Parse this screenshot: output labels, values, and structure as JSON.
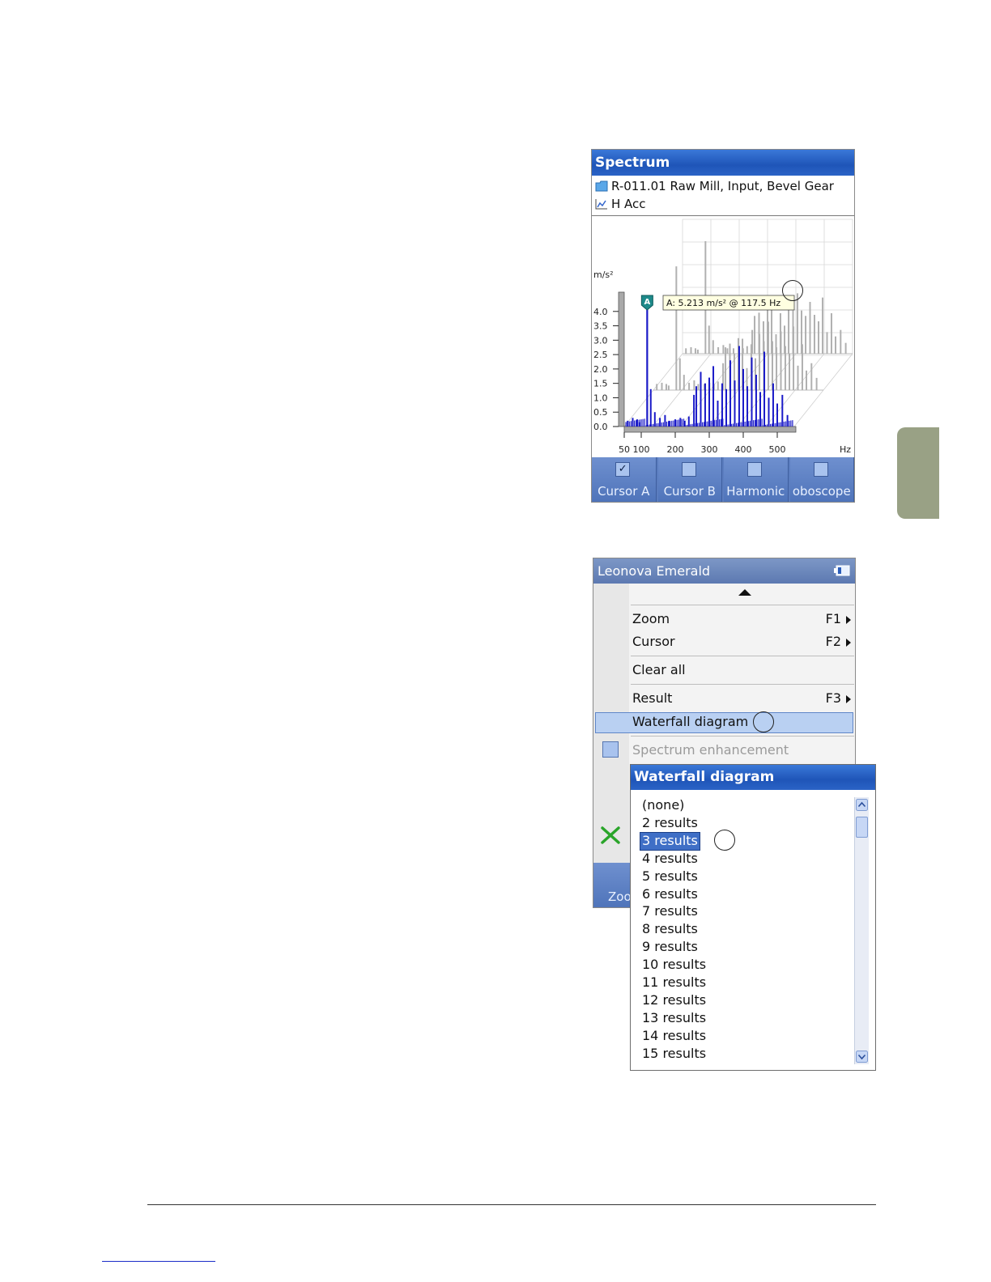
{
  "spectrum": {
    "title": "Spectrum",
    "location": "R-011.01 Raw Mill, Input, Bevel Gear",
    "measurement": "H Acc",
    "chart_data": {
      "type": "bar",
      "y_unit": "m/s²",
      "x_unit": "Hz",
      "y_ticks": [
        "4.0",
        "3.5",
        "3.0",
        "2.5",
        "2.0",
        "1.5",
        "1.0",
        "0.5",
        "0.0"
      ],
      "x_ticks": [
        "50",
        "100",
        "200",
        "300",
        "400",
        "500"
      ],
      "ylim": [
        0,
        4.5
      ],
      "xlim": [
        50,
        550
      ],
      "cursor_label": "A",
      "cursor_readout": "A: 5.213 m/s² @ 117.5 Hz",
      "cursor_x": 117.5,
      "cursor_y": 5.213,
      "series": [
        {
          "x": [
            60,
            75,
            88,
            95,
            117.5,
            128,
            140,
            155,
            170,
            182,
            200,
            215,
            228,
            240,
            255,
            262,
            275,
            288,
            300,
            312,
            325,
            338,
            350,
            362,
            375,
            388,
            400,
            412,
            425,
            438,
            450,
            462,
            475,
            488,
            500,
            515,
            530
          ],
          "values": [
            0.2,
            0.3,
            0.25,
            0.15,
            5.213,
            1.3,
            0.5,
            0.3,
            0.4,
            0.2,
            0.25,
            0.3,
            0.2,
            0.35,
            1.1,
            1.4,
            1.9,
            1.5,
            1.7,
            2.1,
            0.9,
            1.5,
            1.3,
            2.3,
            1.6,
            2.8,
            2.0,
            1.4,
            2.4,
            1.8,
            1.2,
            2.6,
            1.0,
            1.5,
            0.8,
            1.1,
            0.4
          ],
          "color": "#1a1ac8"
        }
      ],
      "background_traces_color": "#b0b0b0"
    },
    "toolbar": [
      {
        "label": "Cursor A",
        "checked": true
      },
      {
        "label": "Cursor B",
        "checked": false
      },
      {
        "label": "Harmonic",
        "checked": false
      },
      {
        "label": "oboscope",
        "checked": false
      }
    ]
  },
  "menu": {
    "title": "Leonova Emerald",
    "items": [
      {
        "label": "Zoom",
        "key": "F1"
      },
      {
        "label": "Cursor",
        "key": "F2"
      },
      {
        "label": "Clear all"
      },
      {
        "label": "Result",
        "key": "F3"
      },
      {
        "label": "Waterfall diagram"
      },
      {
        "label": "Spectrum enhancement"
      }
    ],
    "bottom_label": "Zoo"
  },
  "waterfall": {
    "title": "Waterfall diagram",
    "options": [
      "(none)",
      "2 results",
      "3 results",
      "4 results",
      "5 results",
      "6 results",
      "7 results",
      "8 results",
      "9 results",
      "10 results",
      "11 results",
      "12 results",
      "13 results",
      "14 results",
      "15 results"
    ],
    "selected": "3 results"
  },
  "colors": {
    "xp_title": "#2a63c6",
    "accent_tab": "#99a185",
    "selection": "#3f6fc6",
    "spectrum_trace": "#1a1ac8"
  }
}
